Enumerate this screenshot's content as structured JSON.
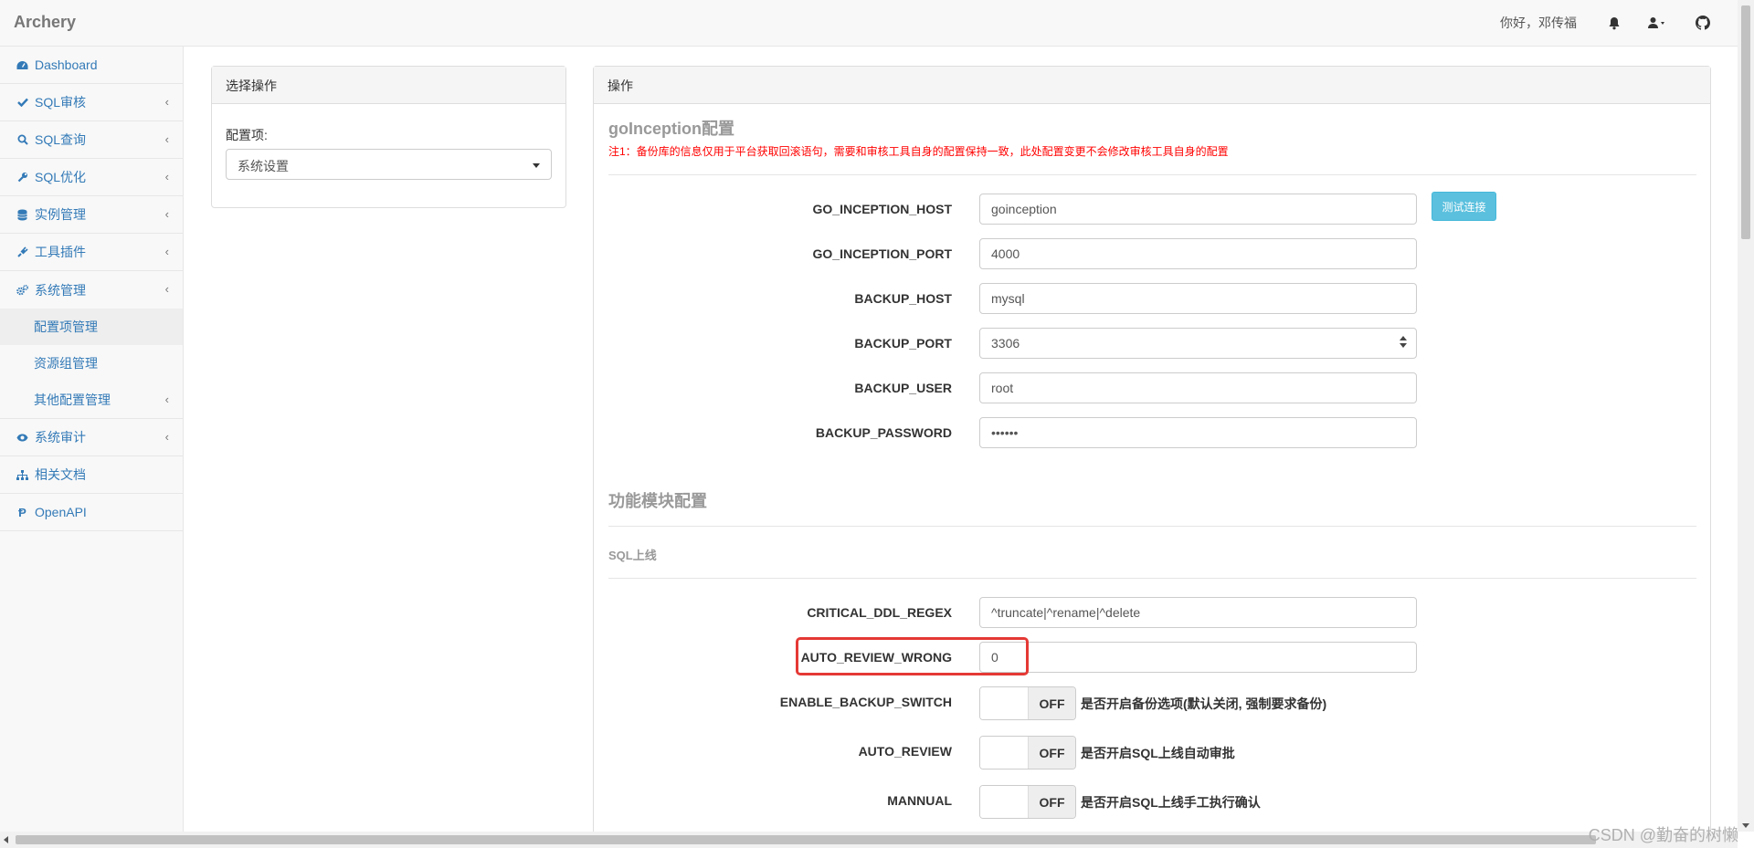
{
  "app": {
    "brand": "Archery"
  },
  "navbar": {
    "greeting": "你好，邓传福",
    "icons": [
      "bell-icon",
      "user-icon",
      "github-icon"
    ]
  },
  "sidebar": {
    "items": [
      {
        "label": "Dashboard",
        "icon": "dashboard-icon"
      },
      {
        "label": "SQL审核",
        "icon": "check-icon"
      },
      {
        "label": "SQL查询",
        "icon": "search-icon"
      },
      {
        "label": "SQL优化",
        "icon": "wrench-icon"
      },
      {
        "label": "实例管理",
        "icon": "database-icon"
      },
      {
        "label": "工具插件",
        "icon": "plug-icon"
      },
      {
        "label": "系统管理",
        "icon": "gears-icon"
      },
      {
        "label": "系统审计",
        "icon": "eye-icon"
      },
      {
        "label": "相关文档",
        "icon": "sitemap-icon"
      },
      {
        "label": "OpenAPI",
        "icon": "api-icon"
      }
    ],
    "subitems": [
      {
        "label": "配置项管理"
      },
      {
        "label": "资源组管理"
      },
      {
        "label": "其他配置管理"
      }
    ]
  },
  "left_panel": {
    "heading": "选择操作",
    "config_label": "配置项:",
    "config_select": "系统设置"
  },
  "right_panel": {
    "heading": "操作",
    "goinception_title": "goInception配置",
    "goinception_note": "注1：备份库的信息仅用于平台获取回滚语句，需要和审核工具自身的配置保持一致，此处配置变更不会修改审核工具自身的配置",
    "test_button": "测试连接",
    "fields": [
      {
        "label": "GO_INCEPTION_HOST",
        "value": "goinception"
      },
      {
        "label": "GO_INCEPTION_PORT",
        "value": "4000"
      },
      {
        "label": "BACKUP_HOST",
        "value": "mysql"
      },
      {
        "label": "BACKUP_PORT",
        "value": "3306"
      },
      {
        "label": "BACKUP_USER",
        "value": "root"
      },
      {
        "label": "BACKUP_PASSWORD",
        "value": "••••••"
      }
    ],
    "module_title": "功能模块配置",
    "sql_online_title": "SQL上线",
    "module_fields": [
      {
        "label": "CRITICAL_DDL_REGEX",
        "value": "^truncate|^rename|^delete"
      },
      {
        "label": "AUTO_REVIEW_WRONG",
        "value": "0"
      }
    ],
    "switches": [
      {
        "label": "ENABLE_BACKUP_SWITCH",
        "state": "OFF",
        "help": "是否开启备份选项(默认关闭, 强制要求备份)"
      },
      {
        "label": "AUTO_REVIEW",
        "state": "OFF",
        "help": "是否开启SQL上线自动审批"
      },
      {
        "label": "MANNUAL",
        "state": "OFF",
        "help": "是否开启SQL上线手工执行确认"
      }
    ]
  },
  "watermark": "CSDN @勤奋的树懒",
  "colors": {
    "link": "#337ab7",
    "note": "#ff0000",
    "highlight": "#e53935",
    "button": "#5bc0de"
  }
}
